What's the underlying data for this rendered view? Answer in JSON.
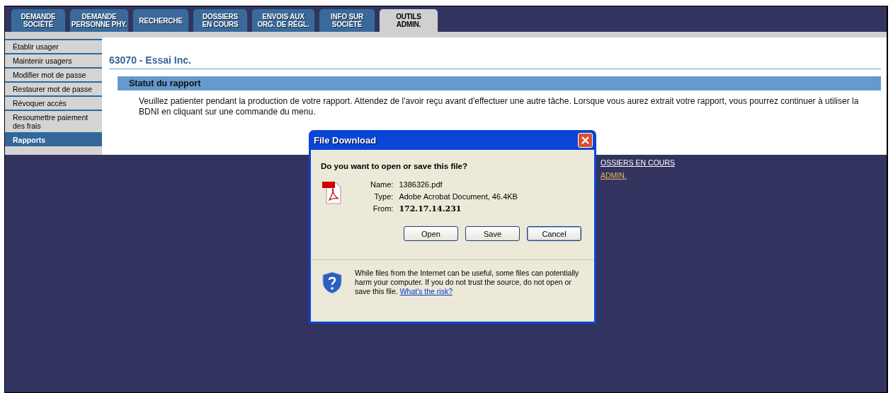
{
  "tabs": [
    {
      "label": "DEMANDE\nSOCIÉTÉ",
      "selected": false
    },
    {
      "label": "DEMANDE\nPERSONNE PHY.",
      "selected": false
    },
    {
      "label": "RECHERCHE",
      "selected": false
    },
    {
      "label": "DOSSIERS\nEN COURS",
      "selected": false
    },
    {
      "label": "ENVOIS AUX\nORG. DE RÉGL.",
      "selected": false
    },
    {
      "label": "INFO SUR\nSOCIÉTÉ",
      "selected": false
    },
    {
      "label": "OUTILS\nADMIN.",
      "selected": true
    }
  ],
  "sidebar": {
    "items": [
      {
        "label": "Établir usager",
        "selected": false
      },
      {
        "label": "Maintenir usagers",
        "selected": false
      },
      {
        "label": "Modifier mot de passe",
        "selected": false
      },
      {
        "label": "Restaurer mot de passe",
        "selected": false
      },
      {
        "label": "Révoquer accès",
        "selected": false
      },
      {
        "label": "Resoumettre paiement des frais",
        "selected": false
      },
      {
        "label": "Rapports",
        "selected": true
      }
    ]
  },
  "page_title": "63070 - Essai Inc.",
  "section": {
    "title": "Statut du rapport",
    "message": "Veuillez patienter pendant la production de votre rapport. Attendez de l'avoir reçu avant d'effectuer une autre tâche. Lorsque vous aurez extrait votre rapport, vous pourrez continuer à utiliser la BDNI en cliquant sur une commande du menu."
  },
  "footer_links": [
    {
      "label": "OSSIERS EN COURS",
      "visited": false
    },
    {
      "label": "ADMIN.",
      "visited": true
    }
  ],
  "dialog": {
    "title": "File Download",
    "question": "Do you want to open or save this file?",
    "fields": [
      {
        "label": "Name:",
        "value": "1386326.pdf"
      },
      {
        "label": "Type:",
        "value": "Adobe Acrobat Document, 46.4KB"
      },
      {
        "label": "From:",
        "value": "172.17.14.231"
      }
    ],
    "buttons": [
      {
        "label": "Open",
        "default": false
      },
      {
        "label": "Save",
        "default": false
      },
      {
        "label": "Cancel",
        "default": true
      }
    ],
    "warning": "While files from the Internet can be useful, some files can potentially harm your computer. If you do not trust the source, do not open or save this file.",
    "warning_link": "What's the risk?"
  }
}
